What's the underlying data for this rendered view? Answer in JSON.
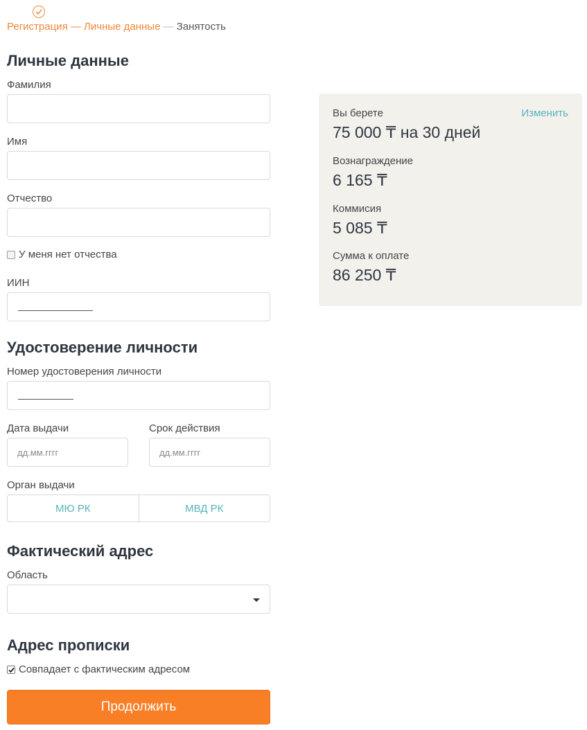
{
  "stepper": {
    "step1": "Регистрация",
    "sep1": " — ",
    "step2": "Личные данные",
    "sep2": " — ",
    "step3": "Занятость"
  },
  "personal": {
    "heading": "Личные данные",
    "surname_label": "Фамилия",
    "surname_value": "",
    "name_label": "Имя",
    "name_value": "",
    "patronymic_label": "Отчество",
    "patronymic_value": "",
    "no_patronymic_label": "У меня нет отчества",
    "iin_label": "ИИН"
  },
  "identity": {
    "heading": "Удостоверение личности",
    "number_label": "Номер удостоверения личности",
    "issue_date_label": "Дата выдачи",
    "issue_date_placeholder": "дд.мм.гггг",
    "expiry_label": "Срок действия",
    "expiry_placeholder": "дд.мм.гггг",
    "authority_label": "Орган выдачи",
    "authority_options": [
      "МЮ РК",
      "МВД РК"
    ]
  },
  "address": {
    "heading": "Фактический адрес",
    "region_label": "Область",
    "region_value": ""
  },
  "registration": {
    "heading": "Адрес прописки",
    "same_address_label": "Совпадает с фактическим адресом",
    "same_address_checked": true
  },
  "submit_label": "Продолжить",
  "summary": {
    "take_label": "Вы берете",
    "change_link": "Изменить",
    "take_value": "75 000 ₸ на 30 дней",
    "reward_label": "Вознаграждение",
    "reward_value": "6 165 ₸",
    "commission_label": "Коммисия",
    "commission_value": "5 085 ₸",
    "total_label": "Сумма к оплате",
    "total_value": "86 250 ₸"
  },
  "colors": {
    "accent_orange": "#f97f26",
    "link_teal": "#57b3bd",
    "card_bg": "#f3f1ec"
  }
}
